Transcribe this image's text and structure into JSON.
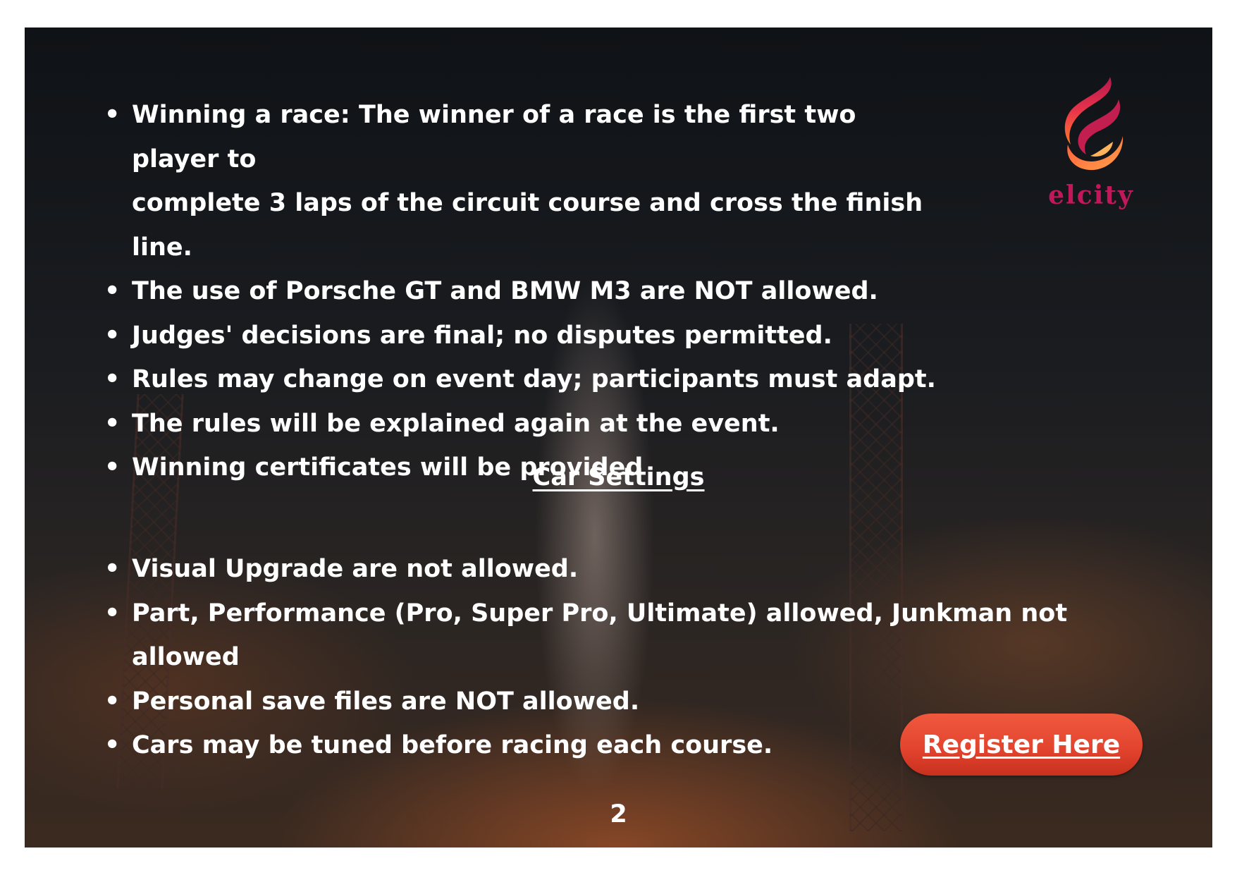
{
  "rules": [
    {
      "line1": "Winning a race: The winner of a race is the first two player to",
      "line2": "complete 3 laps of the circuit course and cross the finish line."
    },
    {
      "line1": "The use of Porsche GT and BMW M3 are NOT allowed."
    },
    {
      "line1": "Judges' decisions are final; no disputes permitted."
    },
    {
      "line1": "Rules may change on event day; participants must adapt."
    },
    {
      "line1": "The rules will be explained again at the event."
    },
    {
      "line1": "Winning certificates will be provided"
    }
  ],
  "car_settings": {
    "heading": "Car Settings",
    "items": [
      "Visual Upgrade are not allowed.",
      "Part, Performance (Pro, Super Pro, Ultimate) allowed, Junkman not allowed",
      "Personal save files are NOT allowed.",
      "Cars may be tuned before racing each course."
    ]
  },
  "logo": {
    "wordmark": "elcity",
    "colors": {
      "flame_top": "#b5174f",
      "flame_mid": "#e8344a",
      "flame_bottom": "#ff7a2f"
    }
  },
  "register_button": {
    "label": "Register Here",
    "color": "#e3452f"
  },
  "page_number": "2",
  "bullet_symbol": "•"
}
